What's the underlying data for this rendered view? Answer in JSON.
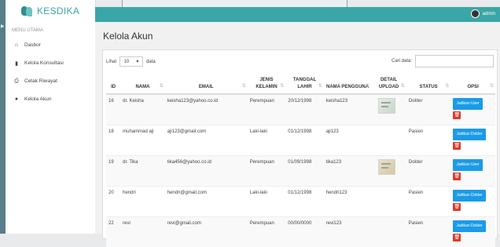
{
  "brand": {
    "name": "KESDIKA"
  },
  "sidebar": {
    "menu_title": "MENU UTAMA",
    "items": [
      {
        "label": "Dasbor",
        "icon": "home-icon"
      },
      {
        "label": "Kelola Konsultasi",
        "icon": "file-icon"
      },
      {
        "label": "Cetak Riwayat",
        "icon": "print-icon"
      },
      {
        "label": "Kelola Akun",
        "icon": "users-icon"
      }
    ]
  },
  "header": {
    "user": "admin"
  },
  "page": {
    "title": "Kelola Akun"
  },
  "table_controls": {
    "show_label": "Lihat",
    "page_length": "10",
    "entries_label": "data",
    "search_label": "Cari data:"
  },
  "table": {
    "columns": [
      "ID",
      "NAMA",
      "EMAIL",
      "JENIS KELAMIN",
      "TANGGAL LAHIR",
      "NAMA PENGGUNA",
      "DETAIL UPLOAD",
      "STATUS",
      "OPSI"
    ],
    "rows": [
      {
        "id": "16",
        "nama": "dr. Keisha",
        "email": "keisha123@yahoo.co.id",
        "jk": "Perempuan",
        "tgl": "20/12/1998",
        "username": "keisha123",
        "has_upload": true,
        "status": "Dokter",
        "action": "Jadikan User"
      },
      {
        "id": "18",
        "nama": "muhammad aji",
        "email": "aji123@gmail.com",
        "jk": "Laki-laki",
        "tgl": "01/12/1998",
        "username": "aji123",
        "has_upload": false,
        "status": "Pasien",
        "action": "Jadikan Dokter"
      },
      {
        "id": "19",
        "nama": "dr. Tika",
        "email": "tika456@yahoo.co.id",
        "jk": "Perempuan",
        "tgl": "01/09/1998",
        "username": "tika123",
        "has_upload": true,
        "status": "Dokter",
        "action": "Jadikan User"
      },
      {
        "id": "20",
        "nama": "hendri",
        "email": "hendri@gmail.com",
        "jk": "Laki-laki",
        "tgl": "01/12/1998",
        "username": "hendri123",
        "has_upload": false,
        "status": "Pasien",
        "action": "Jadikan Dokter"
      },
      {
        "id": "22",
        "nama": "revi",
        "email": "revi@gmail.com",
        "jk": "Perempuan",
        "tgl": "00/00/0000",
        "username": "revi123",
        "has_upload": false,
        "status": "Pasien",
        "action": "Jadikan Dokter"
      }
    ]
  },
  "colors": {
    "accent": "#3aa6a5",
    "primary_button": "#1a9be8",
    "danger_button": "#dd3b2b"
  }
}
